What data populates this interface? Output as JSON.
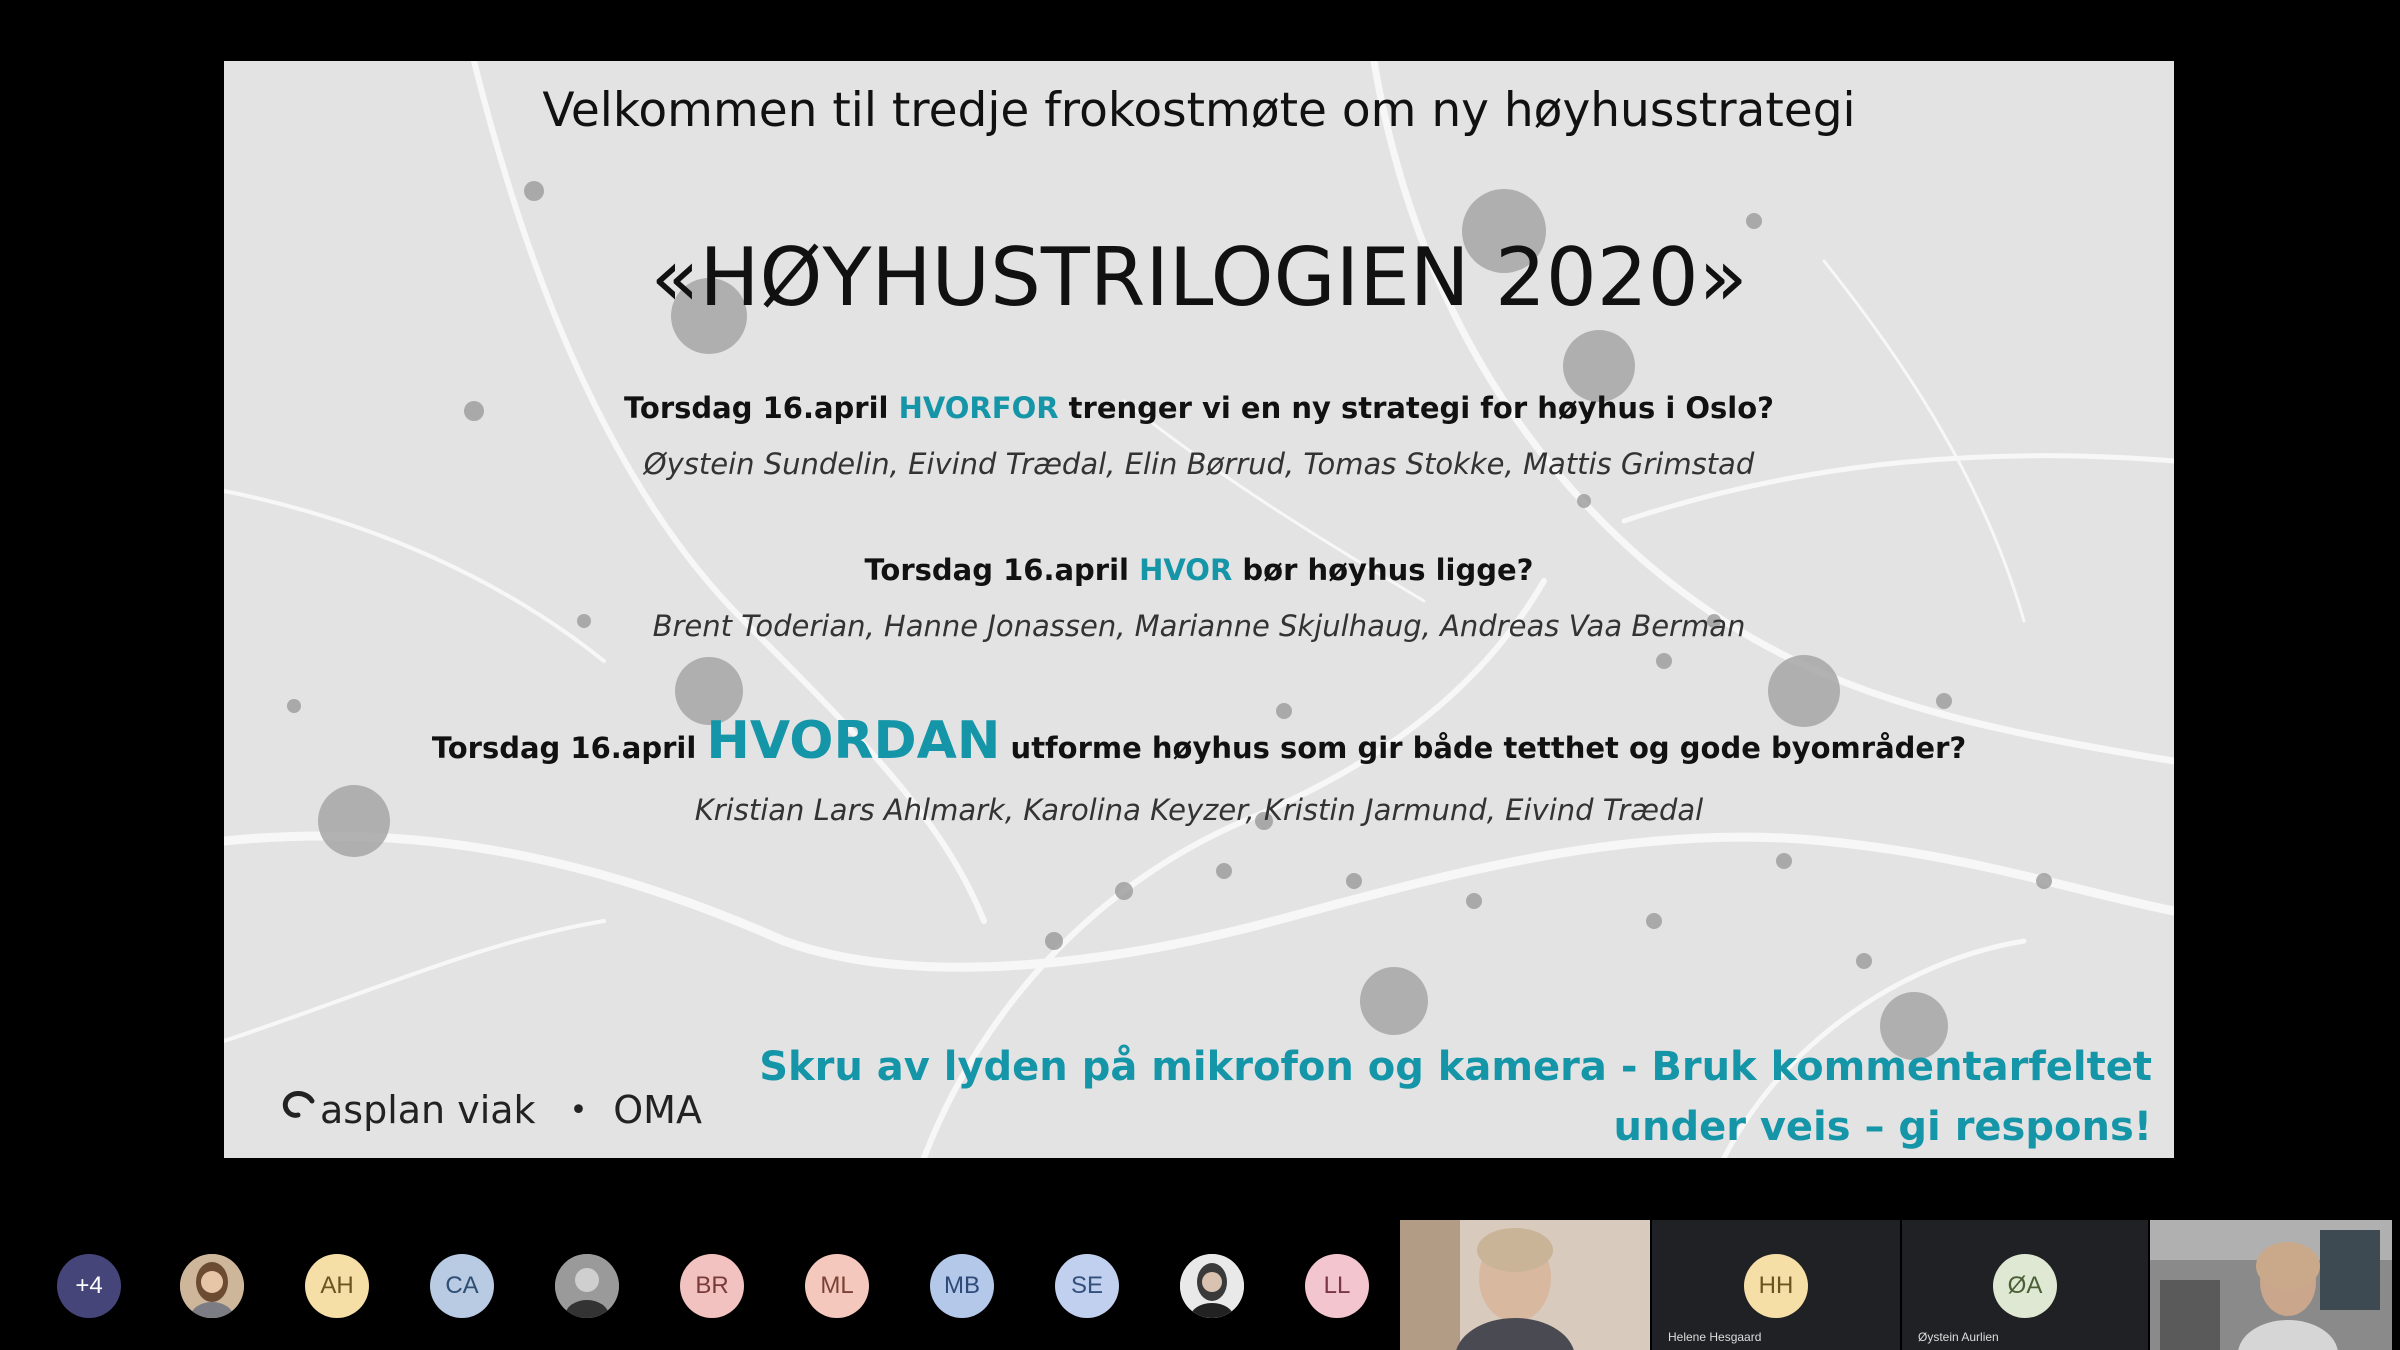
{
  "slide": {
    "welcome": "Velkommen til tredje frokostmøte om ny høyhusstrategi",
    "title": "«HØYHUSTRILOGIEN 2020»",
    "sessions": [
      {
        "date": "Torsdag 16.april",
        "keyword": "HVORFOR",
        "rest": "trenger vi en ny strategi for høyhus i Oslo?",
        "speakers": "Øystein Sundelin, Eivind Trædal, Elin Børrud, Tomas Stokke, Mattis Grimstad"
      },
      {
        "date": "Torsdag 16.april",
        "keyword": "HVOR",
        "rest": "bør høyhus ligge?",
        "speakers": "Brent Toderian, Hanne Jonassen, Marianne Skjulhaug, Andreas Vaa Berman"
      },
      {
        "date": "Torsdag 16.april",
        "keyword": "HVORDAN",
        "rest": "utforme høyhus som gir både tetthet og gode byområder?",
        "speakers": "Kristian Lars Ahlmark, Karolina Keyzer, Kristin Jarmund, Eivind Trædal"
      }
    ],
    "notice_line1": "Skru av lyden på mikrofon og kamera - Bruk kommentarfeltet",
    "notice_line2": "under veis – gi respons!",
    "logo_asplan": "asplan viak",
    "logo_separator": "•",
    "logo_oma": "OMA",
    "accent_color": "#1595a8"
  },
  "participants": {
    "more": "+4",
    "initials": [
      "AH",
      "CA",
      "BR",
      "ML",
      "MB",
      "SE",
      "LL",
      "HH",
      "ØA"
    ],
    "tiles": [
      {
        "initials": "HH",
        "name": "Helene Hesgaard"
      },
      {
        "initials": "ØA",
        "name": "Øystein Aurlien"
      }
    ]
  }
}
